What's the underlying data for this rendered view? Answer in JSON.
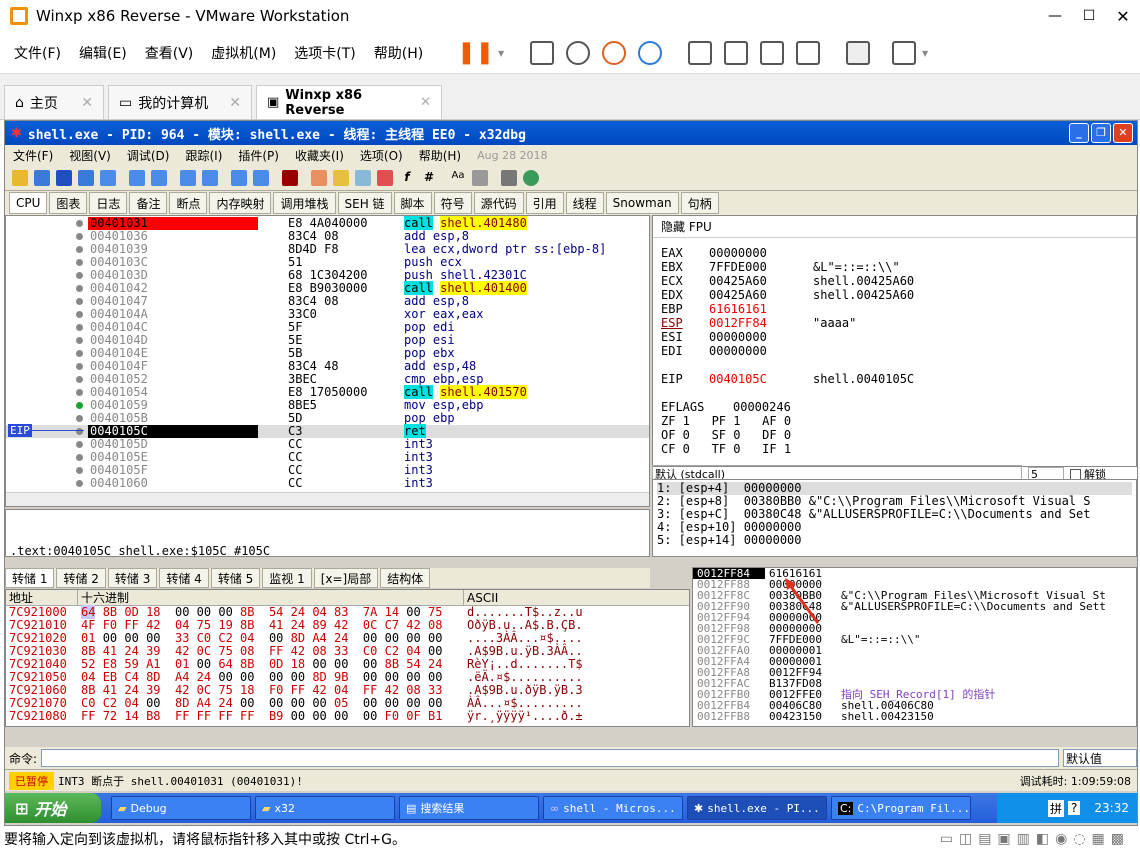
{
  "vm": {
    "title": "Winxp x86 Reverse - VMware Workstation",
    "menu": [
      "文件(F)",
      "编辑(E)",
      "查看(V)",
      "虚拟机(M)",
      "选项卡(T)",
      "帮助(H)"
    ],
    "tabs": [
      "主页",
      "我的计算机",
      "Winxp x86 Reverse"
    ],
    "status": "要将输入定向到该虚拟机，请将鼠标指针移入其中或按 Ctrl+G。"
  },
  "dbg": {
    "title": "shell.exe - PID: 964 - 模块: shell.exe - 线程: 主线程 EE0 - x32dbg",
    "menu": [
      "文件(F)",
      "视图(V)",
      "调试(D)",
      "跟踪(I)",
      "插件(P)",
      "收藏夹(I)",
      "选项(O)",
      "帮助(H)",
      "Aug 28 2018"
    ],
    "tabs": [
      "CPU",
      "图表",
      "日志",
      "备注",
      "断点",
      "内存映射",
      "调用堆栈",
      "SEH 链",
      "脚本",
      "符号",
      "源代码",
      "引用",
      "线程",
      "Snowman",
      "句柄"
    ],
    "disasm": [
      [
        "00401031",
        "E8 4A040000",
        "call shell.401480"
      ],
      [
        "00401036",
        "83C4 08",
        "add esp,8"
      ],
      [
        "00401039",
        "8D4D F8",
        "lea ecx,dword ptr ss:[ebp-8]"
      ],
      [
        "0040103C",
        "51",
        "push ecx"
      ],
      [
        "0040103D",
        "68 1C304200",
        "push shell.42301C"
      ],
      [
        "00401042",
        "E8 B9030000",
        "call shell.401400"
      ],
      [
        "00401047",
        "83C4 08",
        "add esp,8"
      ],
      [
        "0040104A",
        "33C0",
        "xor eax,eax"
      ],
      [
        "0040104C",
        "5F",
        "pop edi"
      ],
      [
        "0040104D",
        "5E",
        "pop esi"
      ],
      [
        "0040104E",
        "5B",
        "pop ebx"
      ],
      [
        "0040104F",
        "83C4 48",
        "add esp,48"
      ],
      [
        "00401052",
        "3BEC",
        "cmp ebp,esp"
      ],
      [
        "00401054",
        "E8 17050000",
        "call shell.401570"
      ],
      [
        "00401059",
        "8BE5",
        "mov esp,ebp"
      ],
      [
        "0040105B",
        "5D",
        "pop ebp"
      ],
      [
        "0040105C",
        "C3",
        "ret"
      ],
      [
        "0040105D",
        "CC",
        "int3"
      ],
      [
        "0040105E",
        "CC",
        "int3"
      ],
      [
        "0040105F",
        "CC",
        "int3"
      ],
      [
        "00401060",
        "CC",
        "int3"
      ]
    ],
    "eip_label": "EIP",
    "info": ".text:0040105C shell.exe:$105C #105C",
    "reg_header": "隐藏 FPU",
    "regs": [
      [
        "EAX",
        "00000000",
        ""
      ],
      [
        "EBX",
        "7FFDE000",
        "&L\"=::=::\\\\\""
      ],
      [
        "ECX",
        "00425A60",
        "shell.00425A60"
      ],
      [
        "EDX",
        "00425A60",
        "shell.00425A60"
      ],
      [
        "EBP",
        "61616161",
        ""
      ],
      [
        "ESP",
        "0012FF84",
        "\"aaaa\""
      ],
      [
        "ESI",
        "00000000",
        ""
      ],
      [
        "EDI",
        "00000000",
        ""
      ]
    ],
    "eip": [
      "EIP",
      "0040105C",
      "shell.0040105C"
    ],
    "eflags": [
      "EFLAGS",
      "00000246"
    ],
    "flags": [
      "ZF 1   PF 1   AF 0",
      "OF 0   SF 0   DF 0",
      "CF 0   TF 0   IF 1"
    ],
    "callconv": "默认 (stdcall)",
    "callcount": "5",
    "unlock": "解锁",
    "callstack": [
      "1: [esp+4]  00000000",
      "2: [esp+8]  00380BB0 &\"C:\\\\Program Files\\\\Microsoft Visual S",
      "3: [esp+C]  00380C48 &\"ALLUSERSPROFILE=C:\\\\Documents and Set",
      "4: [esp+10] 00000000",
      "5: [esp+14] 00000000"
    ],
    "dumptabs": [
      "转储 1",
      "转储 2",
      "转储 3",
      "转储 4",
      "转储 5",
      "监视 1",
      "[x=]局部",
      "结构体"
    ],
    "dump_headers": [
      "地址",
      "十六进制",
      "ASCII"
    ],
    "dump": [
      [
        "7C921000",
        "64 8B 0D 18 00 00 00 8B 54 24 04 83 7A 14 00 75",
        "d.......T$..z..u"
      ],
      [
        "7C921010",
        "4F F0 FF 42 04 75 19 8B 41 24 89 42 0C C7 42 08",
        "OðÿB.u..A$.B.ÇB."
      ],
      [
        "7C921020",
        "01 00 00 00 33 C0 C2 04 00 8D A4 24 00 00 00 00",
        "....3ÀÂ...¤$...."
      ],
      [
        "7C921030",
        "8B 41 24 39 42 0C 75 08 FF 42 08 33 C0 C2 04 00",
        ".A$9B.u.ÿB.3ÀÂ.."
      ],
      [
        "7C921040",
        "52 E8 59 A1 01 00 64 8B 0D 18 00 00 00 8B 54 24",
        "RèY¡..d.......T$"
      ],
      [
        "7C921050",
        "04 EB C4 8D A4 24 00 00 00 00 8D 9B 00 00 00 00",
        ".ëÄ.¤$.........."
      ],
      [
        "7C921060",
        "8B 41 24 39 42 0C 75 18 F0 FF 42 04 FF 42 08 33",
        ".A$9B.u.ðÿB.ÿB.3"
      ],
      [
        "7C921070",
        "C0 C2 04 00 8D A4 24 00 00 00 00 05 00 00 00 00",
        "ÀÂ...¤$........."
      ],
      [
        "7C921080",
        "FF 72 14 B8 FF FF FF FF B9 00 00 00 00 F0 0F B1",
        "ÿr.¸ÿÿÿÿ¹....ð.±"
      ]
    ],
    "stack": [
      [
        "0012FF84",
        "61616161",
        ""
      ],
      [
        "0012FF88",
        "00000000",
        ""
      ],
      [
        "0012FF8C",
        "00380BB0",
        "&\"C:\\\\Program Files\\\\Microsoft Visual St"
      ],
      [
        "0012FF90",
        "00380C48",
        "&\"ALLUSERSPROFILE=C:\\\\Documents and Sett"
      ],
      [
        "0012FF94",
        "00000000",
        ""
      ],
      [
        "0012FF98",
        "00000000",
        ""
      ],
      [
        "0012FF9C",
        "7FFDE000",
        "&L\"=::=::\\\\\""
      ],
      [
        "0012FFA0",
        "00000001",
        ""
      ],
      [
        "0012FFA4",
        "00000001",
        ""
      ],
      [
        "0012FFA8",
        "0012FF94",
        ""
      ],
      [
        "0012FFAC",
        "B137FD08",
        ""
      ],
      [
        "0012FFB0",
        "0012FFE0",
        "指向 SEH_Record[1] 的指针"
      ],
      [
        "0012FFB4",
        "00406C80",
        "shell.00406C80"
      ],
      [
        "0012FFB8",
        "00423150",
        "shell.00423150"
      ]
    ],
    "cmd_label": "命令:",
    "cmd_default": "默认值",
    "status_paused": "已暂停",
    "status_msg": "INT3 断点于 shell.00401031 (00401031)!",
    "status_time": "调试耗时: 1:09:59:08"
  },
  "taskbar": {
    "start": "开始",
    "items": [
      "Debug",
      "x32",
      "搜索结果",
      "shell - Micros...",
      "shell.exe - PI...",
      "C:\\Program Fil..."
    ],
    "clock": "23:32"
  }
}
